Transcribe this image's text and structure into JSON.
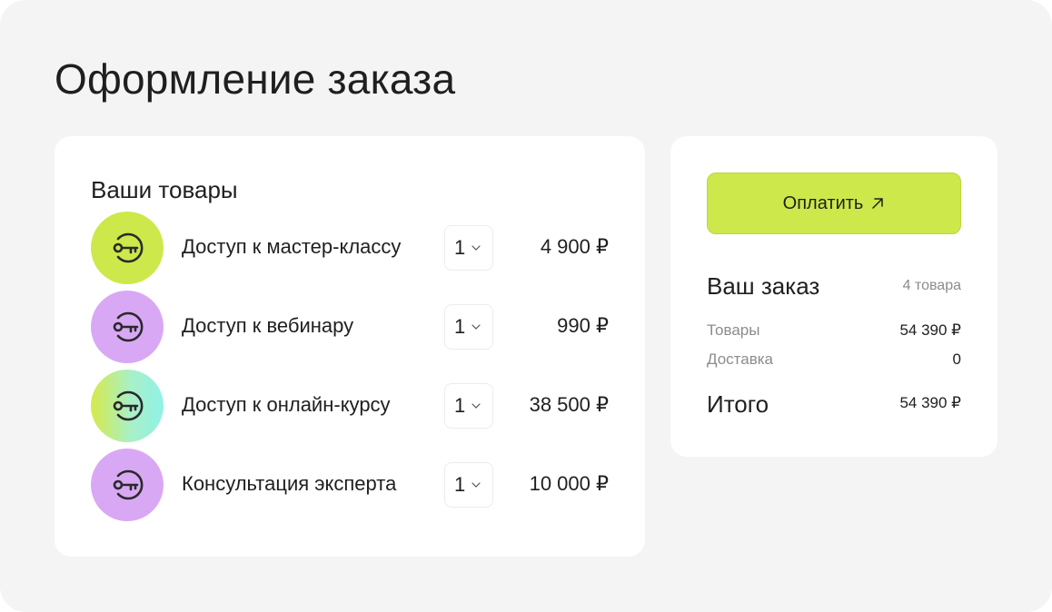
{
  "page": {
    "title": "Оформление заказа"
  },
  "cart": {
    "heading": "Ваши товары",
    "items": [
      {
        "name": "Доступ к мастер-классу",
        "qty": "1",
        "price": "4 900 ₽",
        "icon": "key-icon",
        "icon_color": "#cde84a"
      },
      {
        "name": "Доступ к вебинару",
        "qty": "1",
        "price": "990 ₽",
        "icon": "key-icon",
        "icon_color": "#d9a8f5"
      },
      {
        "name": "Доступ к онлайн-курсу",
        "qty": "1",
        "price": "38 500 ₽",
        "icon": "key-icon",
        "icon_color": "#a8f0c8"
      },
      {
        "name": "Консультация эксперта",
        "qty": "1",
        "price": "10 000 ₽",
        "icon": "key-icon",
        "icon_color": "#d9a8f5"
      }
    ]
  },
  "summary": {
    "pay_label": "Оплатить",
    "pay_icon": "arrow-up-right-icon",
    "title": "Ваш заказ",
    "count": "4 товара",
    "goods_label": "Товары",
    "goods_value": "54 390 ₽",
    "delivery_label": "Доставка",
    "delivery_value": "0",
    "total_label": "Итого",
    "total_value": "54 390 ₽"
  },
  "colors": {
    "accent": "#cde84a",
    "purple": "#d9a8f5",
    "background": "#f4f4f4"
  }
}
